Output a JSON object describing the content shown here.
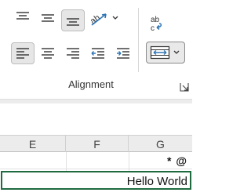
{
  "ribbon": {
    "group_label": "Alignment",
    "buttons": {
      "top_align": "align-top-icon",
      "middle_align": "align-middle-icon",
      "bottom_align": "align-bottom-icon",
      "orientation": "orientation-icon",
      "wrap_text": "wrap-text-icon",
      "align_left": "align-left-icon",
      "center": "align-center-icon",
      "align_right": "align-right-icon",
      "decrease_indent": "decrease-indent-icon",
      "increase_indent": "increase-indent-icon",
      "merge_center": "merge-center-icon"
    },
    "selected": [
      "bottom_align",
      "align_left",
      "merge_center"
    ]
  },
  "sheet": {
    "columns": [
      "E",
      "F",
      "G"
    ],
    "row1_text": "* @",
    "row2_text": "Hello World"
  },
  "colors": {
    "selected_cell_border": "#1f6b40",
    "header_bg": "#ececec",
    "accent_blue": "#2e75b6"
  }
}
